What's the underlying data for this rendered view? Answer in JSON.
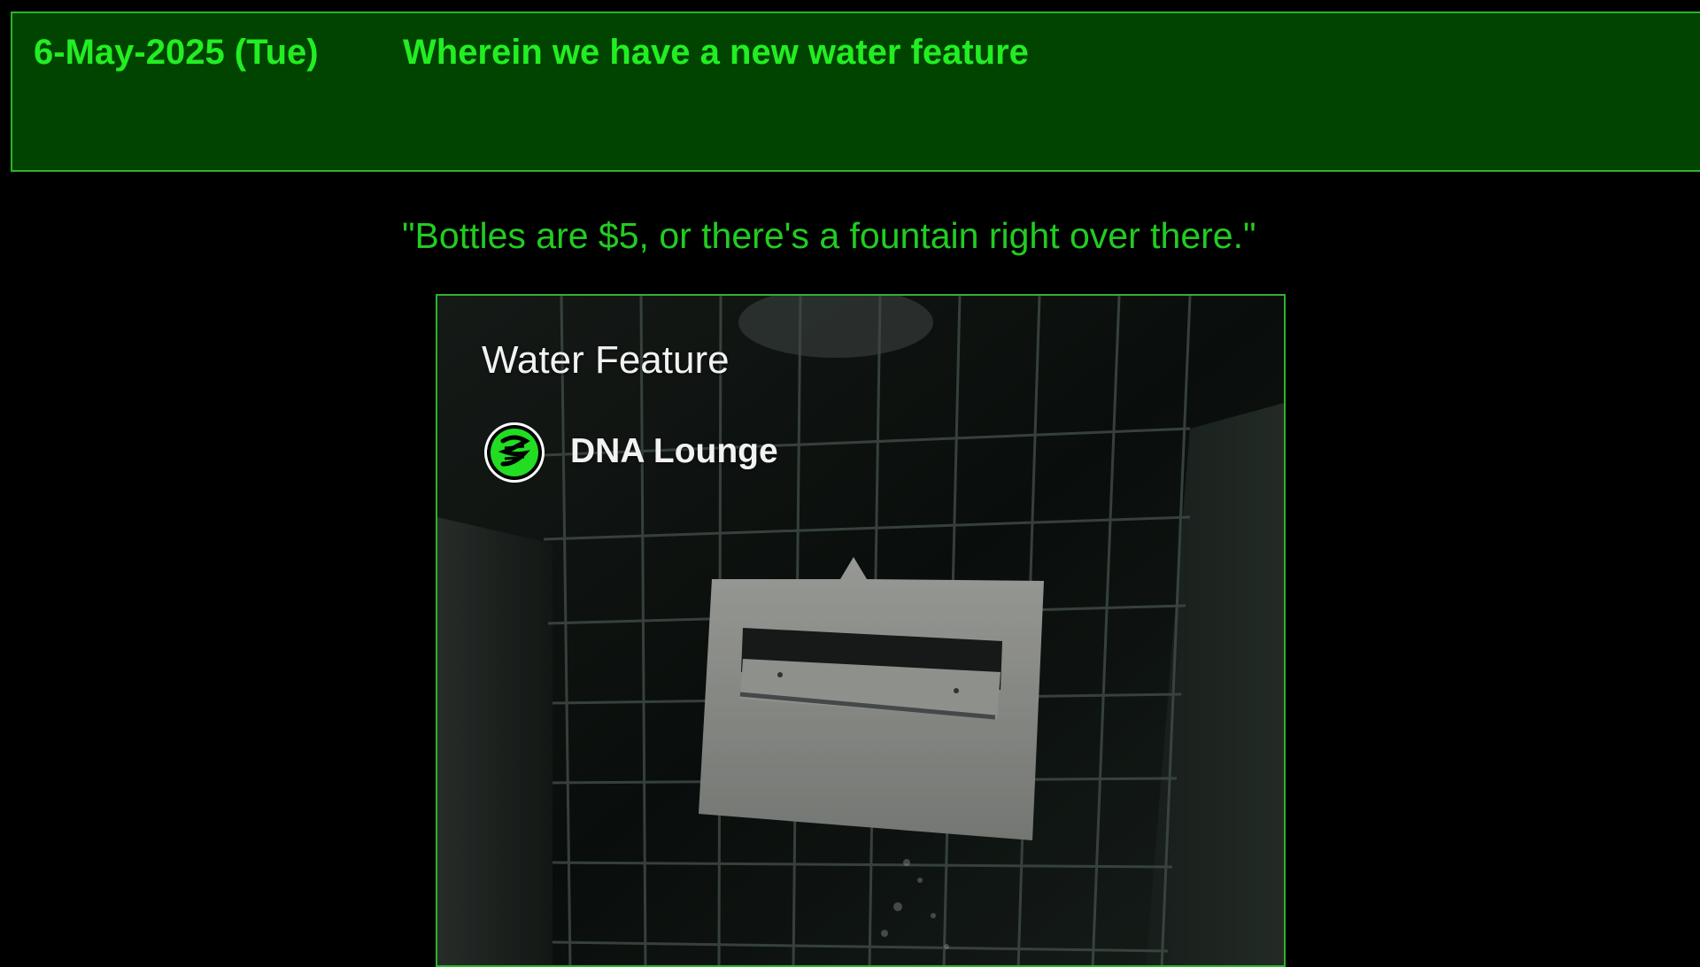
{
  "header": {
    "date": "6-May-2025 (Tue)",
    "title": "Wherein we have a new water feature"
  },
  "quote": "\"Bottles are $5, or there's a fountain right over there.\"",
  "video": {
    "title": "Water Feature",
    "channel_name": "DNA Lounge",
    "channel_avatar_icon": "dna-lounge-logo-icon",
    "thumbnail_subject": "wall-mounted-drinking-fountain"
  },
  "colors": {
    "page_background": "#000000",
    "header_background": "#004400",
    "border_green": "#2db22d",
    "text_green": "#22ee22",
    "quote_green": "#22cc22",
    "overlay_text": "#f2f2f2"
  }
}
